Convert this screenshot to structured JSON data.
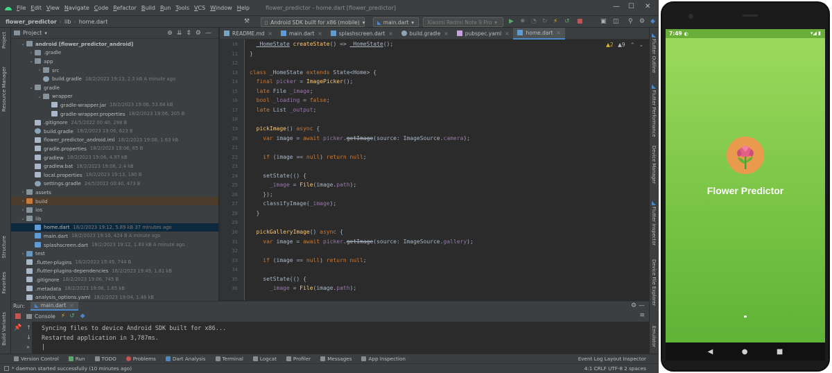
{
  "window": {
    "menu": [
      "File",
      "Edit",
      "View",
      "Navigate",
      "Code",
      "Refactor",
      "Build",
      "Run",
      "Tools",
      "VCS",
      "Window",
      "Help"
    ],
    "title": "flower_predictor - home.dart [flower_predictor]",
    "controls": [
      "—",
      "☐",
      "✕"
    ]
  },
  "navbar": {
    "breadcrumbs": [
      "flower_predictor",
      "lib",
      "home.dart"
    ],
    "device_combo": "Android SDK built for x86 (mobile)",
    "run_config": "main.dart",
    "physical_device": "Xiaomi Redmi Note 9 Pro"
  },
  "left_stripe": [
    "Project",
    "Resource Manager",
    "Structure",
    "Favorites",
    "Build Variants"
  ],
  "right_stripe": [
    "Flutter Outline",
    "Flutter Performance",
    "Device Manager",
    "Flutter Inspector",
    "Device File Explorer",
    "Emulator"
  ],
  "project_panel": {
    "title": "Project",
    "tree": [
      {
        "indent": 1,
        "arrow": "⌄",
        "icon": "folder",
        "name": "android [flower_predictor_android]",
        "meta": "",
        "root": true
      },
      {
        "indent": 2,
        "arrow": "›",
        "icon": "folder",
        "name": ".gradle",
        "meta": ""
      },
      {
        "indent": 2,
        "arrow": "⌄",
        "icon": "folder",
        "name": "app",
        "meta": ""
      },
      {
        "indent": 3,
        "arrow": "›",
        "icon": "folder",
        "name": "src",
        "meta": ""
      },
      {
        "indent": 3,
        "arrow": "",
        "icon": "file-gradle",
        "name": "build.gradle",
        "meta": "18/2/2023 19:13, 2.3 kB A minute ago"
      },
      {
        "indent": 2,
        "arrow": "⌄",
        "icon": "folder",
        "name": "gradle",
        "meta": ""
      },
      {
        "indent": 3,
        "arrow": "⌄",
        "icon": "folder",
        "name": "wrapper",
        "meta": ""
      },
      {
        "indent": 4,
        "arrow": "",
        "icon": "file-gen",
        "name": "gradle-wrapper.jar",
        "meta": "18/2/2023 19:06, 53.64 kB"
      },
      {
        "indent": 4,
        "arrow": "",
        "icon": "file-gen",
        "name": "gradle-wrapper.properties",
        "meta": "18/2/2023 19:06, 205 B"
      },
      {
        "indent": 2,
        "arrow": "",
        "icon": "file-gen",
        "name": ".gitignore",
        "meta": "24/5/2022 00:40, 298 B"
      },
      {
        "indent": 2,
        "arrow": "",
        "icon": "file-gradle",
        "name": "build.gradle",
        "meta": "18/2/2023 19:06, 623 B"
      },
      {
        "indent": 2,
        "arrow": "",
        "icon": "file-gen",
        "name": "flower_predictor_android.iml",
        "meta": "18/2/2023 19:08, 1.63 kB"
      },
      {
        "indent": 2,
        "arrow": "",
        "icon": "file-gen",
        "name": "gradle.properties",
        "meta": "18/2/2023 19:06, 85 B"
      },
      {
        "indent": 2,
        "arrow": "",
        "icon": "file-gen",
        "name": "gradlew",
        "meta": "18/2/2023 19:06, 4.97 kB"
      },
      {
        "indent": 2,
        "arrow": "",
        "icon": "file-gen",
        "name": "gradlew.bat",
        "meta": "18/2/2023 19:06, 2.4 kB"
      },
      {
        "indent": 2,
        "arrow": "",
        "icon": "file-gen",
        "name": "local.properties",
        "meta": "18/2/2023 19:13, 180 B"
      },
      {
        "indent": 2,
        "arrow": "",
        "icon": "file-gradle",
        "name": "settings.gradle",
        "meta": "24/5/2022 00:40, 473 B"
      },
      {
        "indent": 1,
        "arrow": "›",
        "icon": "folder",
        "name": "assets",
        "meta": ""
      },
      {
        "indent": 1,
        "arrow": "›",
        "icon": "folder-orange",
        "name": "build",
        "meta": "",
        "highlight": true
      },
      {
        "indent": 1,
        "arrow": "›",
        "icon": "folder",
        "name": "ios",
        "meta": ""
      },
      {
        "indent": 1,
        "arrow": "⌄",
        "icon": "folder",
        "name": "lib",
        "meta": ""
      },
      {
        "indent": 2,
        "arrow": "",
        "icon": "file-dart",
        "name": "home.dart",
        "meta": "18/2/2023 19:12, 5.89 kB 37 minutes ago",
        "selected": true
      },
      {
        "indent": 2,
        "arrow": "",
        "icon": "file-dart",
        "name": "main.dart",
        "meta": "18/2/2023 19:10, 424 B A minute ago"
      },
      {
        "indent": 2,
        "arrow": "",
        "icon": "file-dart",
        "name": "splashscreen.dart",
        "meta": "18/2/2023 19:12, 1.83 kB A minute ago"
      },
      {
        "indent": 1,
        "arrow": "›",
        "icon": "folder-blue",
        "name": "test",
        "meta": ""
      },
      {
        "indent": 1,
        "arrow": "",
        "icon": "file-gen",
        "name": ".flutter-plugins",
        "meta": "18/2/2023 19:49, 744 B"
      },
      {
        "indent": 1,
        "arrow": "",
        "icon": "file-gen",
        "name": ".flutter-plugins-dependencies",
        "meta": "18/2/2023 19:49, 1.81 kB"
      },
      {
        "indent": 1,
        "arrow": "",
        "icon": "file-gen",
        "name": ".gitignore",
        "meta": "18/2/2023 19:06, 745 B"
      },
      {
        "indent": 1,
        "arrow": "",
        "icon": "file-gen",
        "name": ".metadata",
        "meta": "18/2/2023 19:06, 1.65 kB"
      },
      {
        "indent": 1,
        "arrow": "",
        "icon": "file-gen",
        "name": "analysis_options.yaml",
        "meta": "18/2/2023 19:04, 1.48 kB"
      }
    ]
  },
  "editor": {
    "tabs": [
      {
        "label": "README.md",
        "icon": "md",
        "active": false
      },
      {
        "label": "main.dart",
        "icon": "dart",
        "active": false
      },
      {
        "label": "splashscreen.dart",
        "icon": "dart",
        "active": false
      },
      {
        "label": "build.gradle",
        "icon": "gr",
        "active": false
      },
      {
        "label": "pubspec.yaml",
        "icon": "ya",
        "active": false
      },
      {
        "label": "home.dart",
        "icon": "dart",
        "active": true
      }
    ],
    "inspection": {
      "warnings": "▲2",
      "weak": "▲9"
    },
    "lines": [
      {
        "n": "10",
        "html": "  <span class=\"ul\">_HomeState</span> <span class=\"fn\">createState</span>() => <span class=\"ul\">_HomeState</span>();"
      },
      {
        "n": "11",
        "html": "}"
      },
      {
        "n": "12",
        "html": ""
      },
      {
        "n": "13",
        "html": "<span class=\"kw\">class</span> _HomeState <span class=\"kw\">extends</span> State&lt;Home&gt; {"
      },
      {
        "n": "14",
        "html": "  <span class=\"kw\">final</span> <span class=\"fld\">picker</span> = <span class=\"fn\">ImagePicker</span>();"
      },
      {
        "n": "15",
        "html": "  <span class=\"kw\">late</span> File <span class=\"fld\">_image</span>;"
      },
      {
        "n": "16",
        "html": "  <span class=\"kw\">bool</span> <span class=\"fld\">_loading</span> = <span class=\"kw\">false</span>;"
      },
      {
        "n": "17",
        "html": "  <span class=\"kw\">late</span> List <span class=\"fld\">_output</span>;"
      },
      {
        "n": "18",
        "html": ""
      },
      {
        "n": "19",
        "html": "  <span class=\"fn\">pickImage</span>() <span class=\"kw\">async</span> {"
      },
      {
        "n": "20",
        "html": "    <span class=\"kw\">var</span> image = <span class=\"kw\">await</span> <span class=\"fld\">picker</span>.<span class=\"strk\">getImage</span>(source: ImageSource.<span class=\"prop\">camera</span>);"
      },
      {
        "n": "21",
        "html": ""
      },
      {
        "n": "22",
        "html": "    <span class=\"kw\">if</span> (image == <span class=\"kw\">null</span>) <span class=\"kw\">return null</span>;"
      },
      {
        "n": "23",
        "html": ""
      },
      {
        "n": "24",
        "html": "    setState(() {"
      },
      {
        "n": "25",
        "html": "      <span class=\"fld\">_image</span> = <span class=\"fn\">File</span>(image.<span class=\"prop\">path</span>);"
      },
      {
        "n": "26",
        "html": "    });"
      },
      {
        "n": "27",
        "html": "    classifyImage(<span class=\"fld\">_image</span>);"
      },
      {
        "n": "28",
        "html": "  }"
      },
      {
        "n": "29",
        "html": ""
      },
      {
        "n": "30",
        "html": "  <span class=\"fn\">pickGalleryImage</span>() <span class=\"kw\">async</span> {"
      },
      {
        "n": "31",
        "html": "    <span class=\"kw\">var</span> image = <span class=\"kw\">await</span> <span class=\"fld\">picker</span>.<span class=\"strk\">getImage</span>(source: ImageSource.<span class=\"prop\">gallery</span>);"
      },
      {
        "n": "32",
        "html": ""
      },
      {
        "n": "33",
        "html": "    <span class=\"kw\">if</span> (image == <span class=\"kw\">null</span>) <span class=\"kw\">return null</span>;"
      },
      {
        "n": "34",
        "html": ""
      },
      {
        "n": "35",
        "html": "    setState(() {"
      },
      {
        "n": "36",
        "html": "      <span class=\"fld\">_image</span> = <span class=\"fn\">File</span>(image.<span class=\"prop\">path</span>);"
      }
    ]
  },
  "run_panel": {
    "label": "Run:",
    "tab": "main.dart",
    "console_tab": "Console",
    "lines": [
      "Syncing files to device Android SDK built for x86...",
      "Restarted application in 3,787ms.",
      "|"
    ]
  },
  "bottom_tools": [
    {
      "label": "Version Control",
      "icon": "gen"
    },
    {
      "label": "Run",
      "icon": "green"
    },
    {
      "label": "TODO",
      "icon": "gen"
    },
    {
      "label": "Problems",
      "icon": "red"
    },
    {
      "label": "Dart Analysis",
      "icon": "blue"
    },
    {
      "label": "Terminal",
      "icon": "gen"
    },
    {
      "label": "Logcat",
      "icon": "gen"
    },
    {
      "label": "Profiler",
      "icon": "gen"
    },
    {
      "label": "Messages",
      "icon": "gen"
    },
    {
      "label": "App Inspection",
      "icon": "gen"
    }
  ],
  "bottom_right_tools": "Event Log    Layout Inspector",
  "status": {
    "message": "* daemon started successfully (10 minutes ago)",
    "right": "4:1   CRLF   UTF-8   2 spaces"
  },
  "phone": {
    "time": "7:49",
    "status_icons": "▾◢ ▮",
    "app_title": "Flower Predictor",
    "nav": [
      "◀",
      "●",
      "■"
    ]
  }
}
